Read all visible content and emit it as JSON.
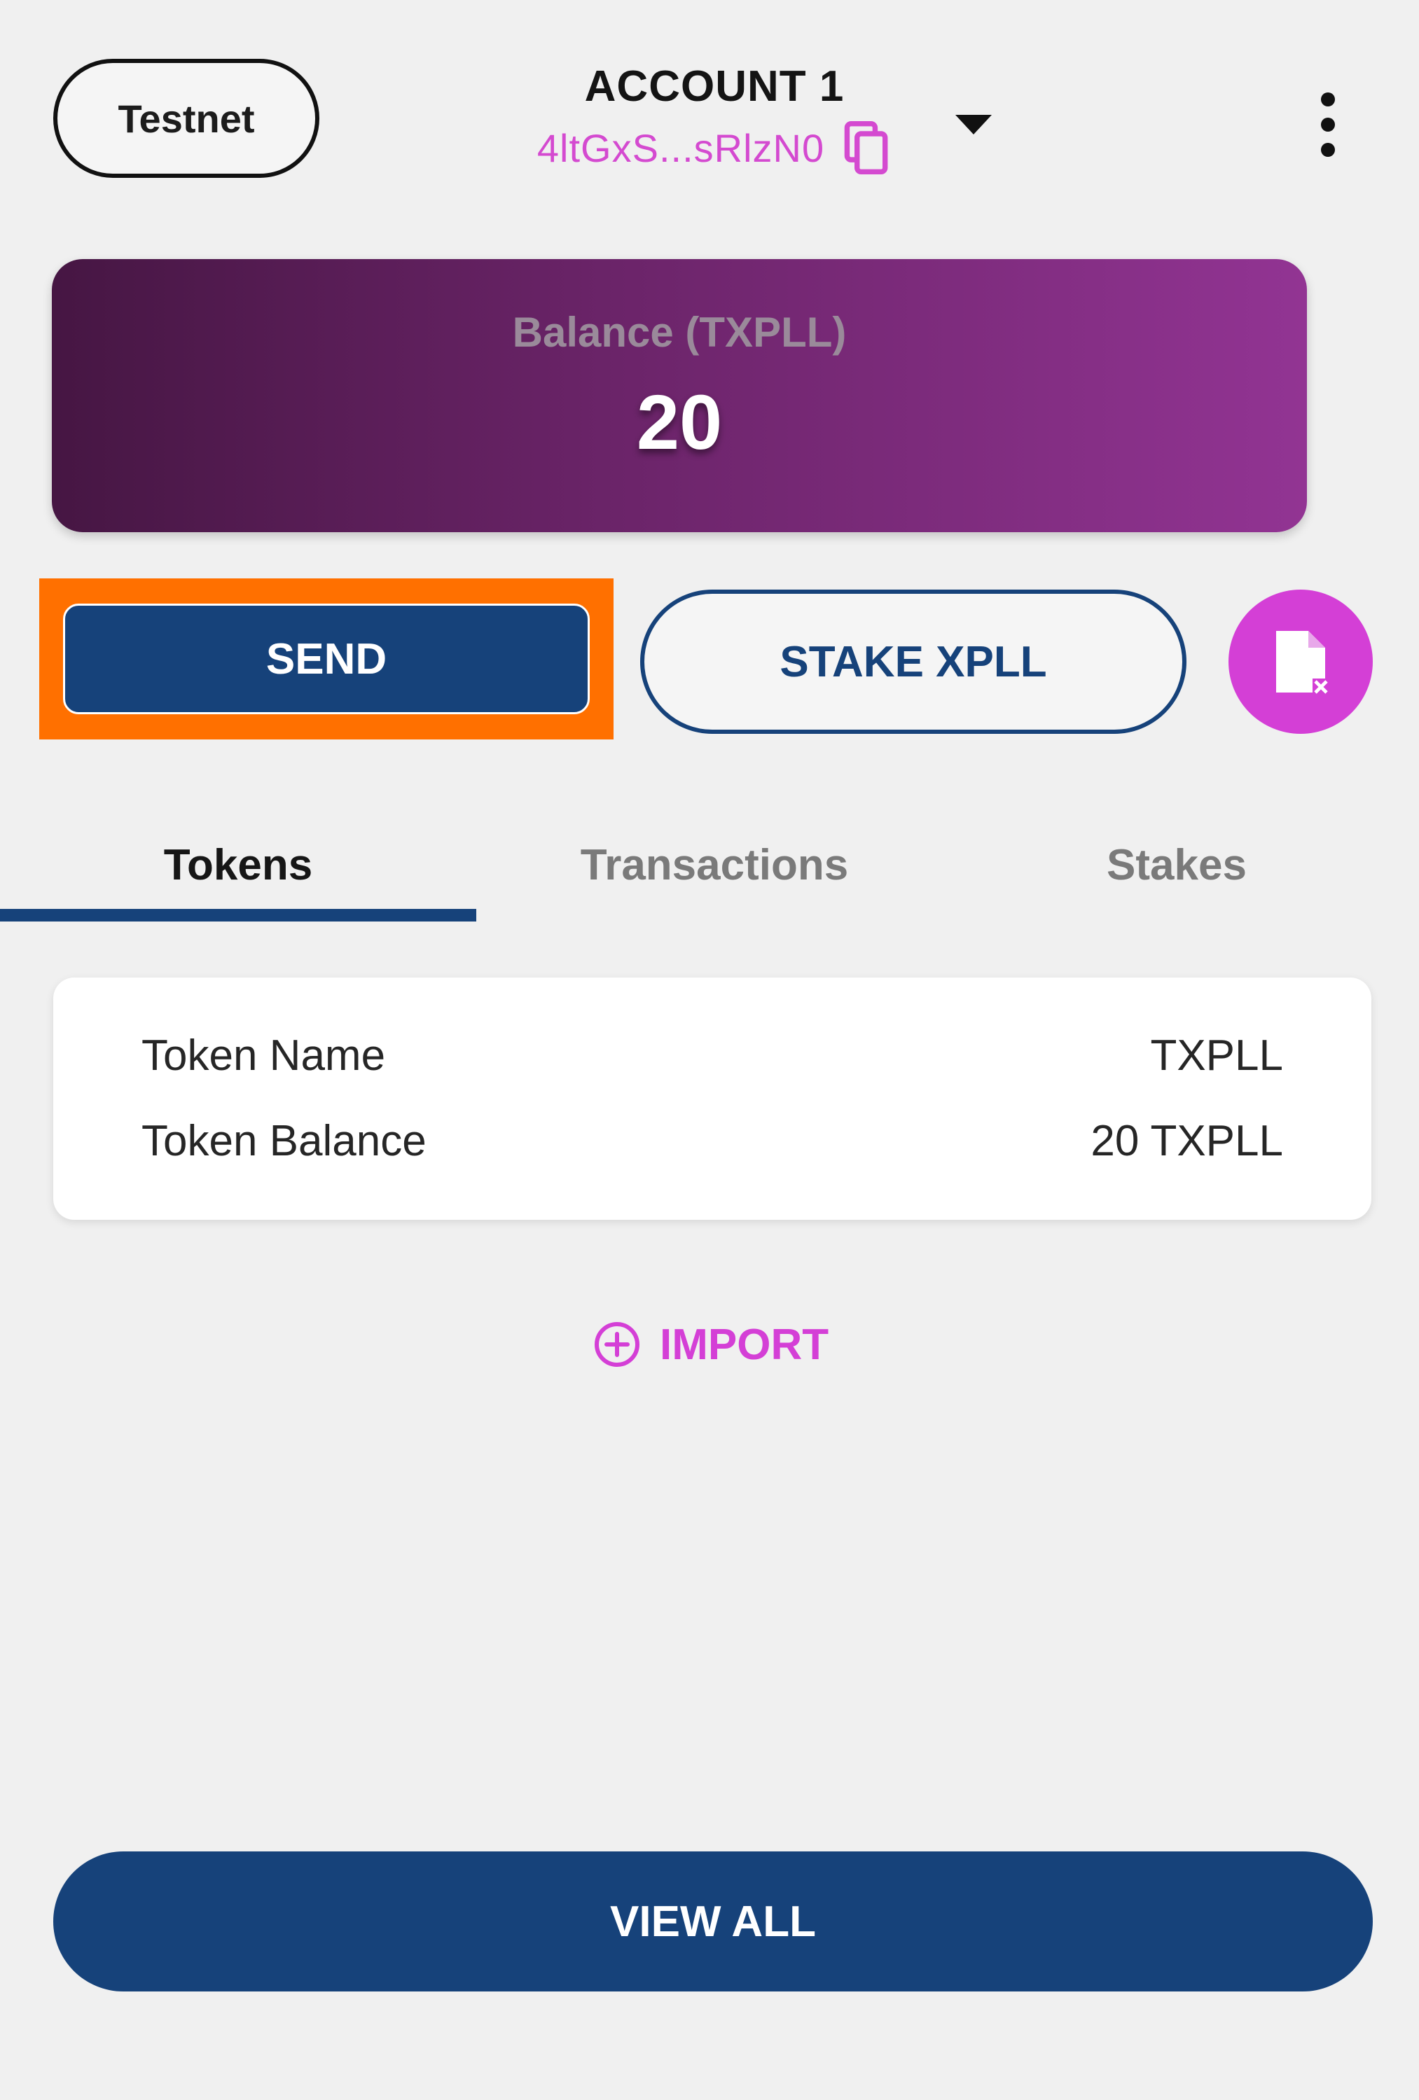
{
  "header": {
    "network_label": "Testnet",
    "account_name": "ACCOUNT 1",
    "account_address": "4ltGxS...sRlzN0"
  },
  "balance": {
    "label": "Balance (TXPLL)",
    "value": "20"
  },
  "actions": {
    "send_label": "SEND",
    "stake_label": "STAKE XPLL"
  },
  "tabs": [
    {
      "label": "Tokens",
      "active": true
    },
    {
      "label": "Transactions",
      "active": false
    },
    {
      "label": "Stakes",
      "active": false
    }
  ],
  "token": {
    "rows": [
      {
        "label": "Token Name",
        "value": "TXPLL"
      },
      {
        "label": "Token Balance",
        "value": "20 TXPLL"
      }
    ]
  },
  "import_label": "IMPORT",
  "view_all_label": "VIEW ALL",
  "colors": {
    "primary_navy": "#16427a",
    "accent_magenta": "#d43fd6",
    "highlight_orange": "#ff7000",
    "card_gradient_start": "#461643",
    "card_gradient_end": "#923493"
  }
}
